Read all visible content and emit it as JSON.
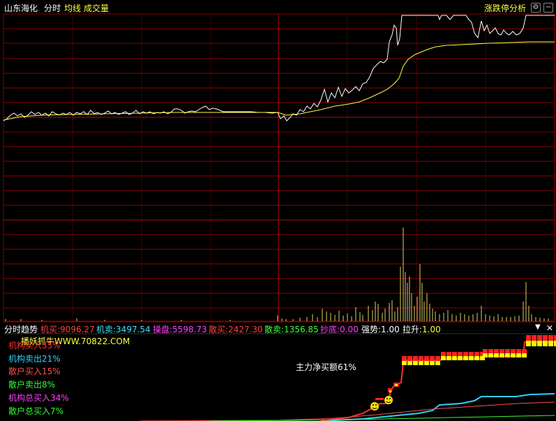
{
  "header": {
    "stock_name": "山东海化",
    "tab_intraday": "分时",
    "tab_avg": "均线",
    "tab_volume": "成交量",
    "limit_analysis": "涨跌停分析",
    "settings_icon": "gear-icon",
    "minus_icon": "minus-icon"
  },
  "indicator": {
    "name": "分时趋势",
    "items": [
      {
        "label": "机买:",
        "value": "9096.27",
        "color": "#ff4040"
      },
      {
        "label": "机卖:",
        "value": "3497.54",
        "color": "#40e0ff"
      },
      {
        "label": "操盘:",
        "value": "5598.73",
        "color": "#ff40ff"
      },
      {
        "label": "散买:",
        "value": "2427.30",
        "color": "#ff4040"
      },
      {
        "label": "散卖:",
        "value": "1356.85",
        "color": "#40ff40"
      },
      {
        "label": "抄底:",
        "value": "0.00",
        "color": "#ff40ff"
      },
      {
        "label": "强势:",
        "value": "1.00",
        "color": "#ffffff"
      },
      {
        "label": "拉升:",
        "value": "1.00",
        "color": "#ffff40"
      }
    ],
    "dropdown_icon": "triangle-down-icon",
    "close_icon": "close-icon"
  },
  "watermark": "播妖抓牛WWW.70822.COM",
  "legend": [
    {
      "text": "机构买入55%",
      "color": "#ff3030"
    },
    {
      "text": "机构卖出21%",
      "color": "#30d0ff"
    },
    {
      "text": "散户买入15%",
      "color": "#ff5050"
    },
    {
      "text": "散户卖出8%",
      "color": "#30ff30"
    },
    {
      "text": "机构总买入34%",
      "color": "#ff40ff"
    },
    {
      "text": "散户总买入7%",
      "color": "#30ff30"
    }
  ],
  "annotation": "主力净买额61%",
  "smiley_icon": "smiley-icon"
}
